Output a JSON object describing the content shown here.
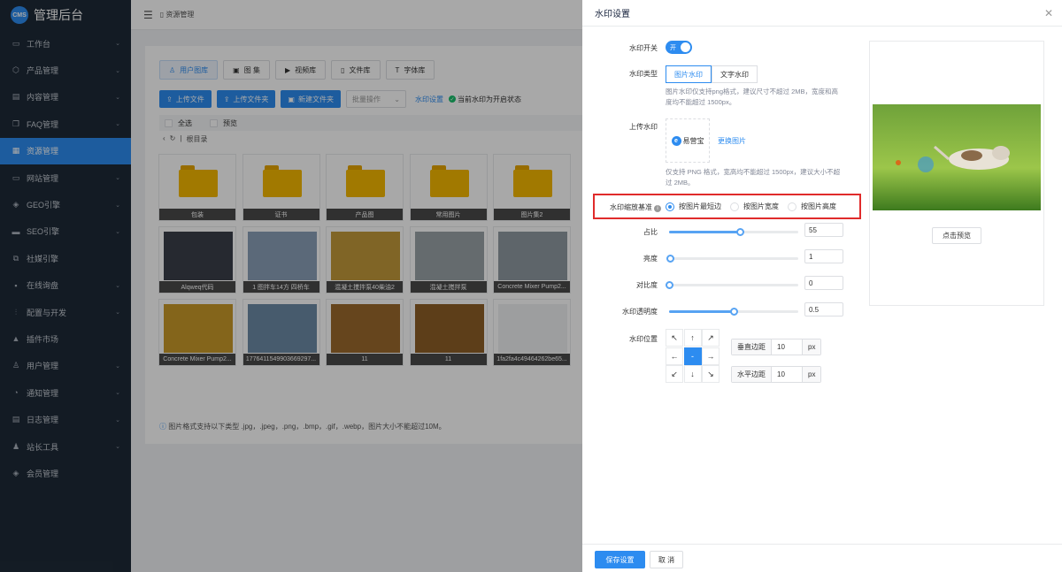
{
  "sidebar": {
    "logo_badge": "CMS",
    "title": "管理后台",
    "items": [
      {
        "label": "工作台",
        "icon": "desktop-icon",
        "glyph": "▭",
        "chevron": true
      },
      {
        "label": "产品管理",
        "icon": "box-icon",
        "glyph": "⬡",
        "chevron": true
      },
      {
        "label": "内容管理",
        "icon": "document-icon",
        "glyph": "▤",
        "chevron": true
      },
      {
        "label": "FAQ管理",
        "icon": "faq-icon",
        "glyph": "❐",
        "chevron": true
      },
      {
        "label": "资源管理",
        "icon": "resource-icon",
        "glyph": "▦",
        "chevron": false,
        "active": true
      },
      {
        "label": "网站管理",
        "icon": "site-icon",
        "glyph": "▭",
        "chevron": true
      },
      {
        "label": "GEO引擎",
        "icon": "geo-icon",
        "glyph": "◈",
        "chevron": true
      },
      {
        "label": "SEO引擎",
        "icon": "seo-icon",
        "glyph": "▬",
        "chevron": true
      },
      {
        "label": "社媒引擎",
        "icon": "social-icon",
        "glyph": "⧉",
        "chevron": false
      },
      {
        "label": "在线询盘",
        "icon": "chat-icon",
        "glyph": "▪",
        "chevron": true
      },
      {
        "label": "配置与开发",
        "icon": "settings-icon",
        "glyph": "⫶",
        "chevron": true
      },
      {
        "label": "插件市场",
        "icon": "plugin-icon",
        "glyph": "▲",
        "chevron": false
      },
      {
        "label": "用户管理",
        "icon": "user-icon",
        "glyph": "♙",
        "chevron": true
      },
      {
        "label": "通知管理",
        "icon": "bell-icon",
        "glyph": "◔",
        "chevron": true
      },
      {
        "label": "日志管理",
        "icon": "log-icon",
        "glyph": "▤",
        "chevron": true
      },
      {
        "label": "站长工具",
        "icon": "tools-icon",
        "glyph": "♟",
        "chevron": true
      },
      {
        "label": "会员管理",
        "icon": "vip-icon",
        "glyph": "◈",
        "chevron": false
      }
    ]
  },
  "topbar": {
    "breadcrumb": "▯ 资源管理"
  },
  "main": {
    "tabs": [
      {
        "label": "用户图库",
        "glyph": "♙",
        "icon": "user-gallery-icon",
        "active": true
      },
      {
        "label": "图 集",
        "glyph": "▣",
        "icon": "album-icon"
      },
      {
        "label": "视频库",
        "glyph": "▶",
        "icon": "video-icon"
      },
      {
        "label": "文件库",
        "glyph": "▯",
        "icon": "file-icon"
      },
      {
        "label": "字体库",
        "glyph": "T",
        "icon": "font-icon"
      }
    ],
    "toolbar": {
      "upload_file": "上传文件",
      "upload_folder": "上传文件夹",
      "new_folder": "新建文件夹",
      "batch_placeholder": "批量操作",
      "watermark_link": "水印设置",
      "watermark_status": "当前水印为开启状态"
    },
    "select_all": "全选",
    "preview": "预览",
    "root": "根目录",
    "tiles": [
      {
        "caption": "包装",
        "type": "folder"
      },
      {
        "caption": "证书",
        "type": "folder"
      },
      {
        "caption": "产品图",
        "type": "folder"
      },
      {
        "caption": "常用图片",
        "type": "folder"
      },
      {
        "caption": "图片集2",
        "type": "folder"
      },
      {
        "caption": "Alqweq代码",
        "type": "image",
        "color": "#3a3f4a"
      },
      {
        "caption": "1 图拌车14方 四桥车",
        "type": "image",
        "color": "#8aa0b8"
      },
      {
        "caption": "混凝土搅拌泵40柴油2",
        "type": "image",
        "color": "#c29a3a"
      },
      {
        "caption": "混凝土搅拌泵",
        "type": "image",
        "color": "#9aa3a8"
      },
      {
        "caption": "Concrete Mixer Pump2...",
        "type": "image",
        "color": "#8f9aa2"
      },
      {
        "caption": "Concrete Mixer Pump2...",
        "type": "image",
        "color": "#c89a2a"
      },
      {
        "caption": "177641154990366929​7...",
        "type": "image",
        "color": "#6d8aa6"
      },
      {
        "caption": "11",
        "type": "image",
        "color": "#9b6a2c"
      },
      {
        "caption": "11",
        "type": "image",
        "color": "#8e5e26"
      },
      {
        "caption": "1fa2fa4c49464262be65...",
        "type": "image",
        "color": "#eef0f2"
      }
    ],
    "hint": "图片格式支持以下类型 .jpg，.jpeg，.png，.bmp，.gif，.webp，图片大小不能超过10M。"
  },
  "drawer": {
    "title": "水印设置",
    "switch_label": "水印开关",
    "switch_text": "开",
    "type_label": "水印类型",
    "type_options": [
      "图片水印",
      "文字水印"
    ],
    "type_desc_1": "图片水印仅支持png格式，建议尺寸不超过 2MB，宽度和高",
    "type_desc_2": "度均不能超过 1500px。",
    "upload_label": "上传水印",
    "logo_text": "易营宝",
    "change_image": "更换图片",
    "upload_desc_1": "仅支持 PNG 格式，宽高均不能超过 1500px，建议大小不超",
    "upload_desc_2": "过 2MB。",
    "scale_label": "水印缩放基准",
    "scale_options": [
      "按图片最短边",
      "按图片宽度",
      "按图片高度"
    ],
    "ratio_label": "占比",
    "ratio_value": "55",
    "ratio_fraction": 0.55,
    "brightness_label": "亮度",
    "brightness_value": "1",
    "brightness_fraction": 0.01,
    "contrast_label": "对比度",
    "contrast_value": "0",
    "contrast_fraction": 0.0,
    "opacity_label": "水印透明度",
    "opacity_value": "0.5",
    "opacity_fraction": 0.5,
    "position_label": "水印位置",
    "position_arrows": [
      "↖",
      "↑",
      "↗",
      "←",
      "-",
      "→",
      "↙",
      "↓",
      "↘"
    ],
    "vertical_margin_label": "垂直边距",
    "vertical_margin_value": "10",
    "horizontal_margin_label": "水平边距",
    "horizontal_margin_value": "10",
    "unit": "px",
    "preview_button": "点击预览",
    "save_button": "保存设置",
    "cancel_button": "取 消"
  }
}
